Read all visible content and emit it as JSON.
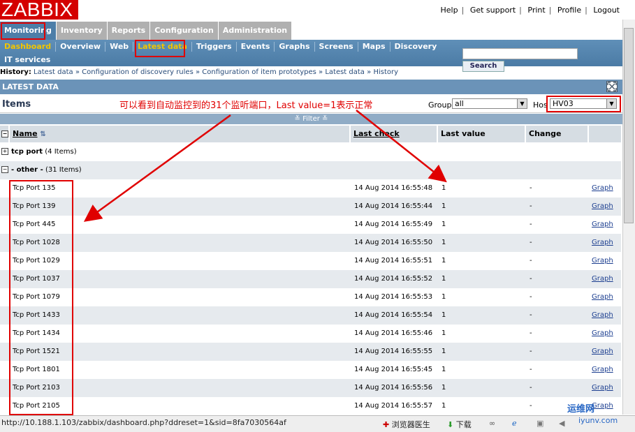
{
  "header": {
    "logo": "ZABBIX",
    "links": [
      "Help",
      "Get support",
      "Print",
      "Profile",
      "Logout"
    ]
  },
  "main_tabs": [
    {
      "label": "Monitoring",
      "active": true
    },
    {
      "label": "Inventory"
    },
    {
      "label": "Reports"
    },
    {
      "label": "Configuration"
    },
    {
      "label": "Administration"
    }
  ],
  "sub_tabs": [
    {
      "label": "Dashboard",
      "active": true
    },
    {
      "label": "Overview"
    },
    {
      "label": "Web"
    },
    {
      "label": "Latest data",
      "active": true
    },
    {
      "label": "Triggers"
    },
    {
      "label": "Events"
    },
    {
      "label": "Graphs"
    },
    {
      "label": "Screens"
    },
    {
      "label": "Maps"
    },
    {
      "label": "Discovery"
    }
  ],
  "sub_tabs_row2": "IT services",
  "search": {
    "button": "Search",
    "value": ""
  },
  "history": {
    "label": "History:",
    "items": [
      "Latest data",
      "Configuration of discovery rules",
      "Configuration of item prototypes",
      "Latest data",
      "History"
    ],
    "separator": "»"
  },
  "section_title": "LATEST DATA",
  "items_title": "Items",
  "annotation": "可以看到自动监控到的31个监听端口，Last value=1表示正常",
  "filters": {
    "group_label": "Group",
    "group_value": "all",
    "host_label": "Hos",
    "host_value": "HV03"
  },
  "filter_bar": "≚ Filter ≚",
  "table": {
    "columns": [
      "Name",
      "Last check",
      "Last value",
      "Change"
    ],
    "groups": [
      {
        "name": "tcp port",
        "count": "(4 Items)"
      },
      {
        "name": "- other -",
        "count": "(31 Items)"
      }
    ],
    "rows": [
      {
        "name": "Tcp Port 135",
        "last_check": "14 Aug 2014 16:55:48",
        "last_value": "1",
        "change": "-",
        "link": "Graph"
      },
      {
        "name": "Tcp Port 139",
        "last_check": "14 Aug 2014 16:55:44",
        "last_value": "1",
        "change": "-",
        "link": "Graph"
      },
      {
        "name": "Tcp Port 445",
        "last_check": "14 Aug 2014 16:55:49",
        "last_value": "1",
        "change": "-",
        "link": "Graph"
      },
      {
        "name": "Tcp Port 1028",
        "last_check": "14 Aug 2014 16:55:50",
        "last_value": "1",
        "change": "-",
        "link": "Graph"
      },
      {
        "name": "Tcp Port 1029",
        "last_check": "14 Aug 2014 16:55:51",
        "last_value": "1",
        "change": "-",
        "link": "Graph"
      },
      {
        "name": "Tcp Port 1037",
        "last_check": "14 Aug 2014 16:55:52",
        "last_value": "1",
        "change": "-",
        "link": "Graph"
      },
      {
        "name": "Tcp Port 1079",
        "last_check": "14 Aug 2014 16:55:53",
        "last_value": "1",
        "change": "-",
        "link": "Graph"
      },
      {
        "name": "Tcp Port 1433",
        "last_check": "14 Aug 2014 16:55:54",
        "last_value": "1",
        "change": "-",
        "link": "Graph"
      },
      {
        "name": "Tcp Port 1434",
        "last_check": "14 Aug 2014 16:55:46",
        "last_value": "1",
        "change": "-",
        "link": "Graph"
      },
      {
        "name": "Tcp Port 1521",
        "last_check": "14 Aug 2014 16:55:55",
        "last_value": "1",
        "change": "-",
        "link": "Graph"
      },
      {
        "name": "Tcp Port 1801",
        "last_check": "14 Aug 2014 16:55:45",
        "last_value": "1",
        "change": "-",
        "link": "Graph"
      },
      {
        "name": "Tcp Port 2103",
        "last_check": "14 Aug 2014 16:55:56",
        "last_value": "1",
        "change": "-",
        "link": "Graph"
      },
      {
        "name": "Tcp Port 2105",
        "last_check": "14 Aug 2014 16:55:57",
        "last_value": "1",
        "change": "-",
        "link": "Graph"
      }
    ]
  },
  "status_bar": {
    "url": "http://10.188.1.103/zabbix/dashboard.php?ddreset=1&sid=8fa7030564af",
    "doctor": "浏览器医生",
    "download": "下载"
  },
  "watermark": {
    "line1": "运维网",
    "line2": "iyunv.com"
  },
  "colors": {
    "logo": "#d40000",
    "active_tab": "#4d7ea8",
    "annotation": "#e00000",
    "sub_active": "#f2c500"
  }
}
